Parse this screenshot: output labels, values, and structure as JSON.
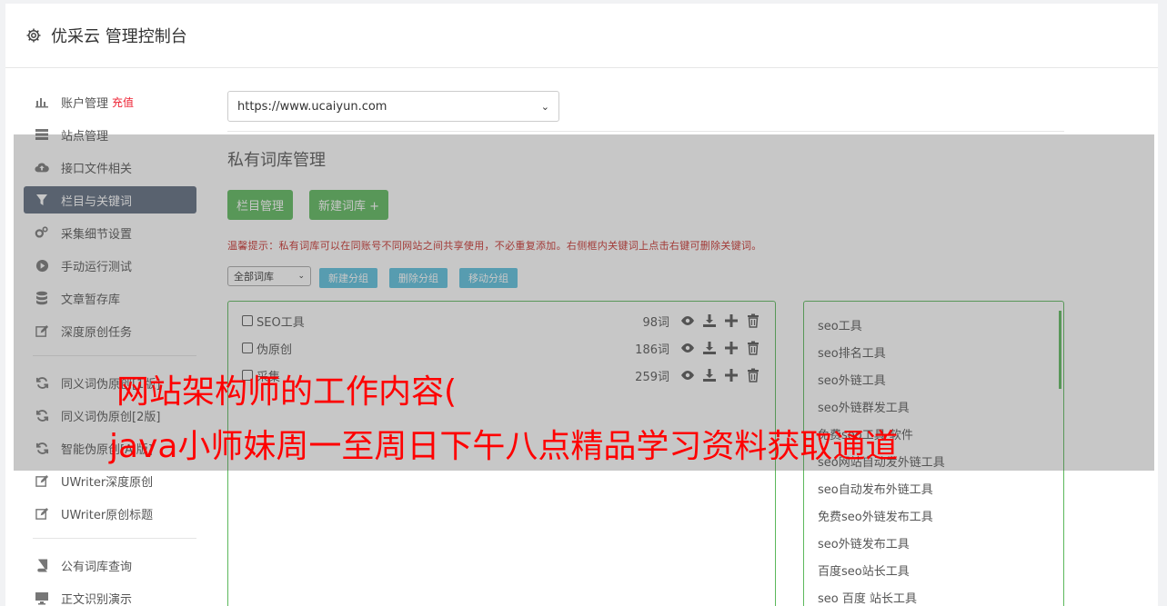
{
  "header": {
    "title": "优采云 管理控制台"
  },
  "sidebar": {
    "group1": [
      {
        "label": "账户管理",
        "badge": "充值",
        "icon": "bar-chart-icon"
      },
      {
        "label": "站点管理",
        "icon": "server-icon"
      },
      {
        "label": "接口文件相关",
        "icon": "cloud-upload-icon"
      },
      {
        "label": "栏目与关键词",
        "icon": "filter-icon",
        "active": true
      },
      {
        "label": "采集细节设置",
        "icon": "cogs-icon"
      },
      {
        "label": "手动运行测试",
        "icon": "play-circle-icon"
      },
      {
        "label": "文章暂存库",
        "icon": "database-icon"
      },
      {
        "label": "深度原创任务",
        "icon": "edit-icon"
      }
    ],
    "group2": [
      {
        "label": "同义词伪原创[1版]",
        "icon": "refresh-icon"
      },
      {
        "label": "同义词伪原创[2版]",
        "icon": "refresh-icon"
      },
      {
        "label": "智能伪原创[AI版]",
        "icon": "refresh-icon"
      },
      {
        "label": "UWriter深度原创",
        "icon": "edit-icon"
      },
      {
        "label": "UWriter原创标题",
        "icon": "edit-icon"
      }
    ],
    "group3": [
      {
        "label": "公有词库查询",
        "icon": "book-icon"
      },
      {
        "label": "正文识别演示",
        "icon": "monitor-icon"
      }
    ]
  },
  "content": {
    "site_select": "https://www.ucaiyun.com",
    "section_title": "私有词库管理",
    "btn_column": "栏目管理",
    "btn_new_lib": "新建词库 +",
    "tip": "温馨提示：私有词库可以在同账号不同网站之间共享使用，不必重复添加。右侧框内关键词上点击右键可删除关键词。",
    "group_select": "全部词库",
    "btn_new_group": "新建分组",
    "btn_delete_group": "删除分组",
    "btn_move_group": "移动分组",
    "libraries": [
      {
        "name": "SEO工具",
        "count": "98词"
      },
      {
        "name": "伪原创",
        "count": "186词"
      },
      {
        "name": "采集",
        "count": "259词"
      }
    ],
    "keywords": [
      "seo工具",
      "seo排名工具",
      "seo外链工具",
      "seo外链群发工具",
      "免费seo工具 软件",
      "seo网站自动发外链工具",
      "seo自动发布外链工具",
      "免费seo外链发布工具",
      "seo外链发布工具",
      "百度seo站长工具",
      "seo 百度 站长工具"
    ]
  },
  "overlay": {
    "line1": "网站架构师的工作内容(",
    "line2": "java小师妹周一至周日下午八点精品学习资料获取通道"
  },
  "colors": {
    "green": "#5cb85c",
    "blue": "#5bc0de",
    "sidebar_active": "#5d6a7e",
    "overlay_text": "#ff0000"
  }
}
